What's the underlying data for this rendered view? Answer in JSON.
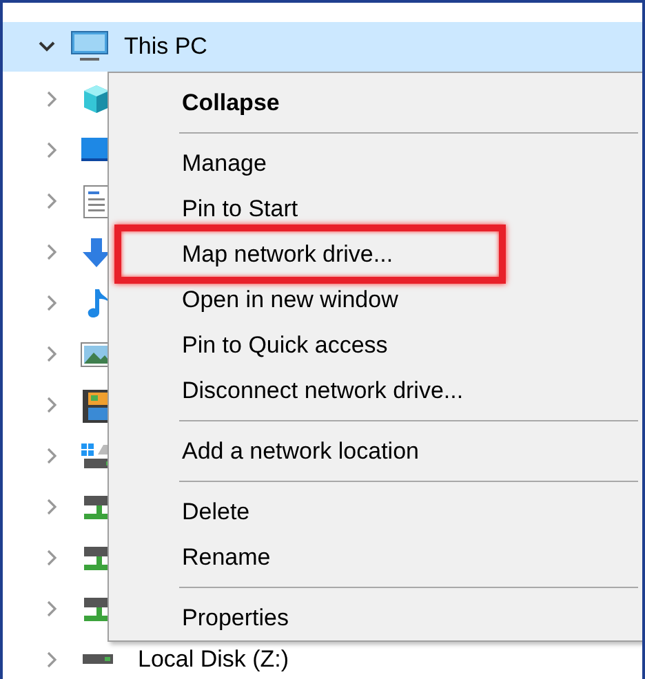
{
  "tree": {
    "root": {
      "label": "This PC",
      "expanded": true,
      "selected": true
    },
    "children": [
      {
        "kind": "cube",
        "expanded": false
      },
      {
        "kind": "desktop",
        "expanded": false
      },
      {
        "kind": "documents",
        "expanded": false
      },
      {
        "kind": "downloads",
        "expanded": false
      },
      {
        "kind": "music",
        "expanded": false
      },
      {
        "kind": "pictures",
        "expanded": false
      },
      {
        "kind": "videos",
        "expanded": false
      },
      {
        "kind": "system-drive",
        "expanded": false
      },
      {
        "kind": "network-drive",
        "expanded": false
      },
      {
        "kind": "network-drive",
        "expanded": false
      },
      {
        "kind": "network-drive",
        "expanded": false
      },
      {
        "kind": "disk",
        "expanded": false,
        "label": "Local Disk (Z:)"
      }
    ]
  },
  "context_menu": {
    "items": [
      {
        "kind": "item",
        "label": "Collapse",
        "default": true
      },
      {
        "kind": "separator"
      },
      {
        "kind": "item",
        "label": "Manage"
      },
      {
        "kind": "item",
        "label": "Pin to Start"
      },
      {
        "kind": "item",
        "label": "Map network drive...",
        "highlighted": true
      },
      {
        "kind": "item",
        "label": "Open in new window"
      },
      {
        "kind": "item",
        "label": "Pin to Quick access"
      },
      {
        "kind": "item",
        "label": "Disconnect network drive..."
      },
      {
        "kind": "separator"
      },
      {
        "kind": "item",
        "label": "Add a network location"
      },
      {
        "kind": "separator"
      },
      {
        "kind": "item",
        "label": "Delete"
      },
      {
        "kind": "item",
        "label": "Rename"
      },
      {
        "kind": "separator"
      },
      {
        "kind": "item",
        "label": "Properties"
      }
    ]
  }
}
